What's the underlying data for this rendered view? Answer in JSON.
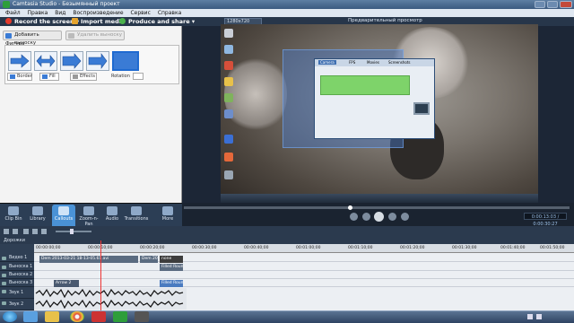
{
  "window": {
    "title": "Camtasia Studio - Безымянный проект"
  },
  "menu": [
    "Файл",
    "Правка",
    "Вид",
    "Воспроизведение",
    "Сервис",
    "Справка"
  ],
  "toolbar": {
    "record_label": "Record the screen ▾",
    "import_label": "Import media",
    "produce_label": "Produce and share ▾"
  },
  "preview": {
    "size_label": "1280x720 Размеры",
    "preview_label": "Предварительный просмотр",
    "time": "0:00:13:03 / 0:00:30:27"
  },
  "callouts_panel": {
    "add_label": "Добавить выноску",
    "remove_label": "Удалить выноску",
    "shapes_label": "Фигура",
    "border_label": "Border",
    "fill_label": "Fill",
    "effects_label": "Effects",
    "rotation_label": "Rotation"
  },
  "tabs": [
    {
      "label": "Clip Bin"
    },
    {
      "label": "Library"
    },
    {
      "label": "Callouts"
    },
    {
      "label": "Zoom-n-Pan"
    },
    {
      "label": "Audio"
    },
    {
      "label": "Transitions"
    },
    {
      "label": "More"
    }
  ],
  "timeline": {
    "zoom_label": "Дорожки",
    "ruler": [
      "00:00:00;00",
      "00:00:10;00",
      "00:00:20;00",
      "00:00:30;00",
      "00:00:40;00",
      "00:01:00;00",
      "00:01:10;00",
      "00:01:20;00",
      "00:01:30;00",
      "00:01:40;00",
      "00:01:50;00"
    ],
    "tracks": [
      "Видео 1",
      "Выноска 1",
      "Выноска 2",
      "Выноска 3",
      "Звук 1",
      "Звук 2"
    ],
    "clips": {
      "video_clip": "Dem 2013-03-21 18-13-05.61.avi",
      "video_clip2": "Dem 201",
      "none_label": "none",
      "filled_round": "Filled Roun",
      "filled_round2": "Filled Roun",
      "arrow_label": "Arrow 2"
    }
  },
  "dialog": {
    "tab1": "Camera",
    "tab2": "FPS",
    "tab3": "Movies",
    "tab4": "Screenshots"
  },
  "colors": {
    "accent": "#4a92d6",
    "toolbar": "#27364a",
    "taskbar": "#3b5a80"
  }
}
